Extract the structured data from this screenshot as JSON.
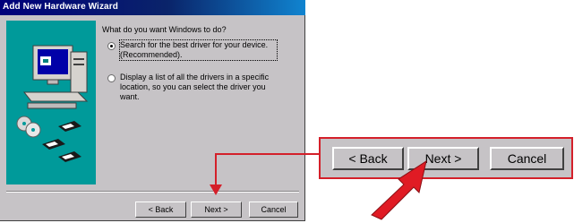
{
  "window": {
    "title": "Add New Hardware Wizard"
  },
  "question": "What do you want Windows to do?",
  "options": [
    {
      "label": "Search for the best driver for your device. (Recommended).",
      "selected": true
    },
    {
      "label": "Display a list of all the drivers in a specific location, so you can select the driver you want.",
      "selected": false
    }
  ],
  "buttons": {
    "back": "< Back",
    "next": "Next >",
    "cancel": "Cancel"
  },
  "colors": {
    "dialog": "#c6c3c6",
    "titlebar": "#00007b",
    "art": "#009a9a",
    "callout": "#d4202a"
  }
}
